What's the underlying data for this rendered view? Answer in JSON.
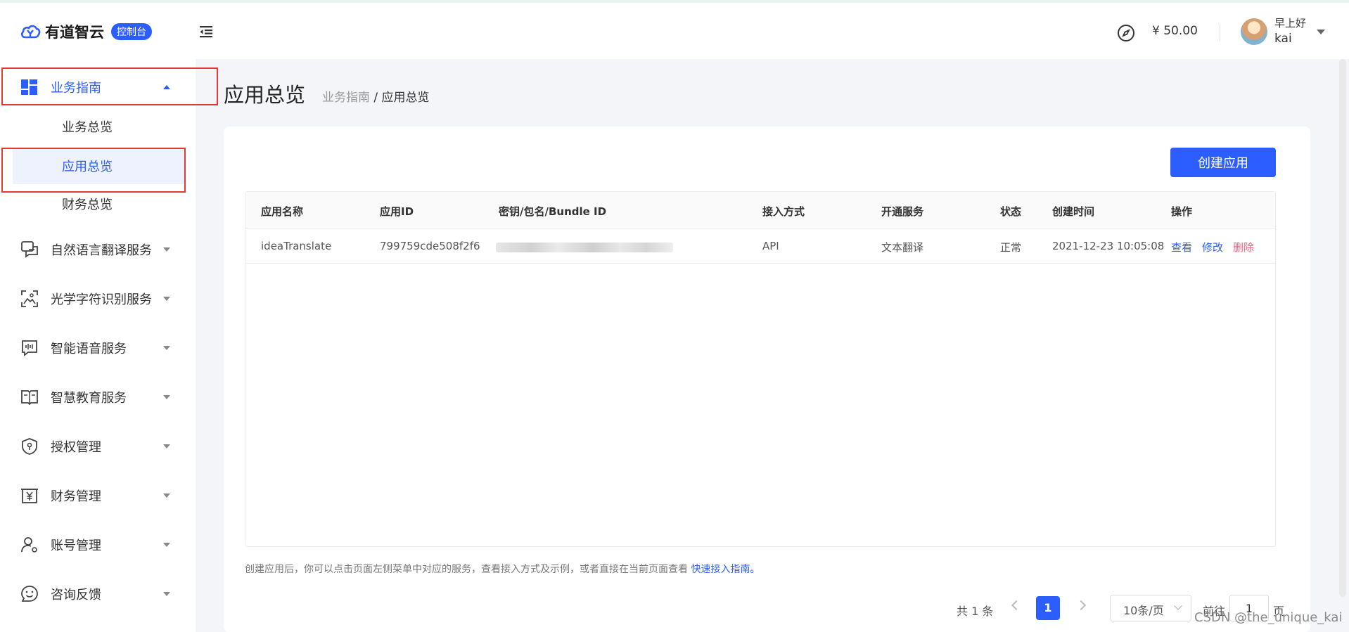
{
  "header": {
    "logo_text": "有道智云",
    "logo_badge": "控制台",
    "balance": "¥ 50.00",
    "greeting": "早上好",
    "username": "kai"
  },
  "sidebar": {
    "items": [
      {
        "label": "业务指南",
        "icon": "dashboard-grid-icon"
      },
      {
        "label": "自然语言翻译服务",
        "icon": "translate-chat-icon"
      },
      {
        "label": "光学字符识别服务",
        "icon": "ocr-scan-icon"
      },
      {
        "label": "智能语音服务",
        "icon": "voice-wave-icon"
      },
      {
        "label": "智慧教育服务",
        "icon": "book-icon"
      },
      {
        "label": "授权管理",
        "icon": "shield-icon"
      },
      {
        "label": "财务管理",
        "icon": "yen-box-icon"
      },
      {
        "label": "账号管理",
        "icon": "user-gear-icon"
      },
      {
        "label": "咨询反馈",
        "icon": "smile-icon"
      }
    ],
    "subitems": [
      {
        "label": "业务总览"
      },
      {
        "label": "应用总览"
      },
      {
        "label": "财务总览"
      }
    ]
  },
  "page": {
    "title": "应用总览",
    "breadcrumb_parent": "业务指南",
    "breadcrumb_sep": " / ",
    "breadcrumb_current": "应用总览",
    "create_button": "创建应用"
  },
  "table": {
    "columns": [
      "应用名称",
      "应用ID",
      "密钥/包名/Bundle ID",
      "接入方式",
      "开通服务",
      "状态",
      "创建时间",
      "操作"
    ],
    "rows": [
      {
        "name": "ideaTranslate",
        "app_id": "799759cde508f2f6",
        "access": "API",
        "service": "文本翻译",
        "status": "正常",
        "created": "2021-12-23 10:05:08",
        "op_view": "查看",
        "op_edit": "修改",
        "op_delete": "删除"
      }
    ]
  },
  "hint": {
    "text": "创建应用后，你可以点击页面左侧菜单中对应的服务，查看接入方式及示例，或者直接在当前页面查看 ",
    "link": "快速接入指南。"
  },
  "pagination": {
    "total": "共 1 条",
    "current_page": "1",
    "page_size": "10条/页",
    "goto_label": "前往",
    "goto_value": "1",
    "page_suffix": "页"
  },
  "watermark": "CSDN @the_unique_kai",
  "colors": {
    "accent": "#2c5eff",
    "danger": "#ff5b7a",
    "highlight_box": "#e53935"
  }
}
